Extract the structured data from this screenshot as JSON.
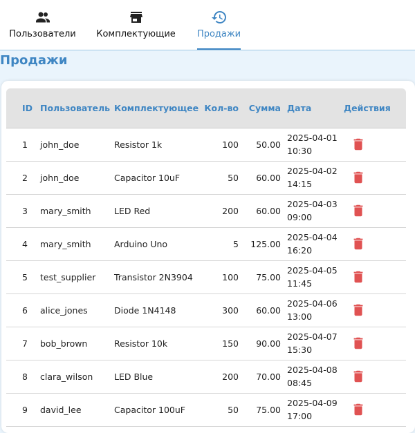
{
  "nav": {
    "tabs": [
      {
        "label": "Пользователи",
        "icon": "people-icon"
      },
      {
        "label": "Комплектующие",
        "icon": "store-icon"
      },
      {
        "label": "Продажи",
        "icon": "history-icon"
      }
    ],
    "active": "Продажи"
  },
  "page": {
    "title": "Продажи"
  },
  "table": {
    "headers": [
      "ID",
      "Пользователь",
      "Комплектующее",
      "Кол-во",
      "Сумма",
      "Дата",
      "Действия"
    ],
    "rows": [
      {
        "id": "1",
        "user": "john_doe",
        "component": "Resistor 1k",
        "qty": "100",
        "sum": "50.00",
        "date": "2025-04-01 10:30"
      },
      {
        "id": "2",
        "user": "john_doe",
        "component": "Capacitor 10uF",
        "qty": "50",
        "sum": "60.00",
        "date": "2025-04-02 14:15"
      },
      {
        "id": "3",
        "user": "mary_smith",
        "component": "LED Red",
        "qty": "200",
        "sum": "60.00",
        "date": "2025-04-03 09:00"
      },
      {
        "id": "4",
        "user": "mary_smith",
        "component": "Arduino Uno",
        "qty": "5",
        "sum": "125.00",
        "date": "2025-04-04 16:20"
      },
      {
        "id": "5",
        "user": "test_supplier",
        "component": "Transistor 2N3904",
        "qty": "100",
        "sum": "75.00",
        "date": "2025-04-05 11:45"
      },
      {
        "id": "6",
        "user": "alice_jones",
        "component": "Diode 1N4148",
        "qty": "300",
        "sum": "60.00",
        "date": "2025-04-06 13:00"
      },
      {
        "id": "7",
        "user": "bob_brown",
        "component": "Resistor 10k",
        "qty": "150",
        "sum": "90.00",
        "date": "2025-04-07 15:30"
      },
      {
        "id": "8",
        "user": "clara_wilson",
        "component": "LED Blue",
        "qty": "200",
        "sum": "70.00",
        "date": "2025-04-08 08:45"
      },
      {
        "id": "9",
        "user": "david_lee",
        "component": "Capacitor 100uF",
        "qty": "50",
        "sum": "75.00",
        "date": "2025-04-09 17:00"
      }
    ]
  },
  "colors": {
    "accent": "#3f86c3",
    "delete": "#e05252",
    "header_bg": "#e3e3e3",
    "page_bg": "#eaf4fc"
  }
}
